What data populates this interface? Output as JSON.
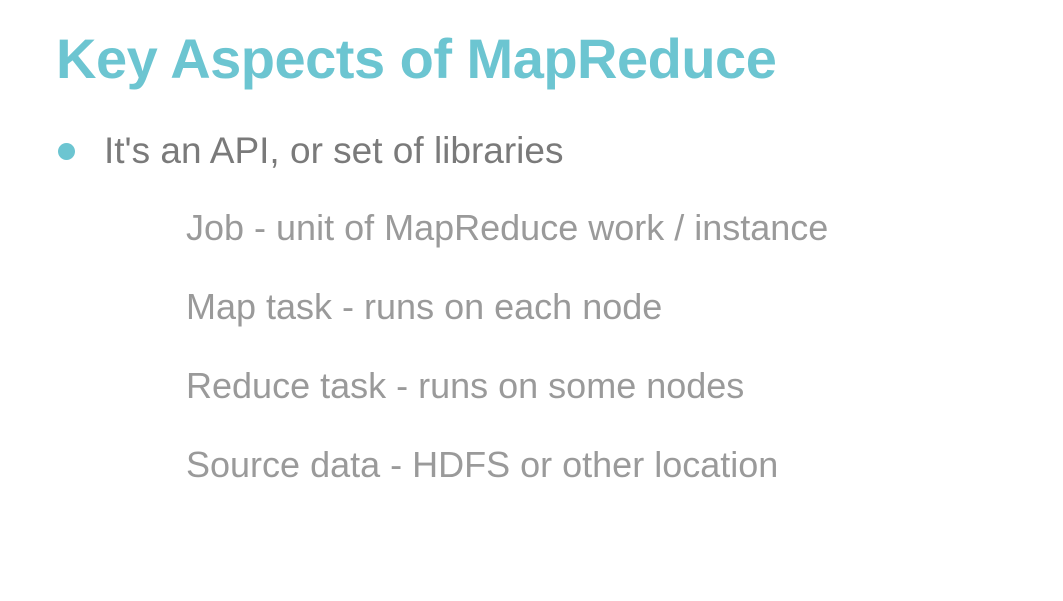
{
  "slide": {
    "title": "Key Aspects of MapReduce",
    "bullet": {
      "text": "It's an API, or set of libraries"
    },
    "sub_items": [
      "Job - unit of MapReduce work / instance",
      "Map task - runs on each node",
      "Reduce task - runs on some nodes",
      "Source data - HDFS or other location"
    ]
  },
  "colors": {
    "accent": "#6cc5d1",
    "bullet_text": "#7a7a7a",
    "sub_text": "#9a9a9a",
    "background": "#ffffff"
  }
}
